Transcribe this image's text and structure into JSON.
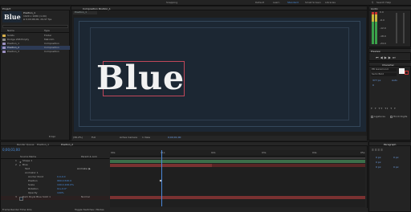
{
  "menubar": {
    "items": [
      "Snapping",
      "Default",
      "Learn",
      "Standard",
      "Small Screen",
      "Libraries"
    ],
    "search_placeholder": "Search Help"
  },
  "project": {
    "tab_label": "Project",
    "preview_title": "Blue",
    "preview_name": "Position_1",
    "preview_info": [
      "1920 x 1080 (1.00)",
      "Δ 0;00;06;00, 29.97 fps"
    ],
    "columns": [
      "Name",
      "Type"
    ],
    "items": [
      {
        "name": "Solids",
        "type": "Folder"
      },
      {
        "name": "Dodge 268 Empty",
        "type": "Mat.Clm"
      },
      {
        "name": "Position_1",
        "type": "Composition"
      },
      {
        "name": "Position_2",
        "type": "Composition"
      },
      {
        "name": "Position_3",
        "type": "Composition"
      }
    ],
    "bpc": "8 bpc"
  },
  "composition": {
    "tab_label": "Composition Position_1",
    "breadcrumb": "Position_1",
    "title_text": "Blue",
    "footer": {
      "zoom": "(36.2%)",
      "resolution": "Full",
      "camera": "Active Camera",
      "views": "1 View",
      "time": "0;00;01;00"
    }
  },
  "info_panel": {
    "tab_label": "Audio",
    "db_labels": [
      "0.0",
      "-3.0",
      "-6.0",
      "-9.0",
      "-12.0",
      "-15.0",
      "-18.0",
      "-21.0",
      "-24.0"
    ]
  },
  "preview_panel": {
    "tab_label": "Preview"
  },
  "character_panel": {
    "tab_label": "Character",
    "font": "EB Garamond",
    "style": "Semi Bold",
    "size": "377 px",
    "leading": "Auto",
    "tracking": "0",
    "options": [
      "Ligatures",
      "Hindi Digits"
    ]
  },
  "timeline": {
    "tabs": [
      "Render Queue",
      "Position_1",
      "Position_2"
    ],
    "timecode": "0;00;01;00",
    "columns": [
      "Source Name",
      "Parent & Link"
    ],
    "layers": [
      {
        "num": "1",
        "name": "Shape 1"
      },
      {
        "num": "2",
        "name": "Blue"
      },
      {
        "name": "Text"
      },
      {
        "name": "Animator 1"
      },
      {
        "name": "Anchor Point",
        "value": "0.0,0.0"
      },
      {
        "name": "Position",
        "value": "960.0,540.0"
      },
      {
        "name": "Scale",
        "value": "100.0,100.0%"
      },
      {
        "name": "Rotation",
        "value": "0x+0.0°"
      },
      {
        "name": "Opacity",
        "value": "100%"
      },
      {
        "num": "3",
        "name": "Dark Royal Blue Solid 1"
      }
    ],
    "ruler_labels": [
      "00s",
      "01s",
      "02s",
      "03s",
      "04s",
      "05s"
    ],
    "footer": [
      "Frame Render Time 4ms",
      "Toggle Switches / Modes"
    ],
    "mode": "Normal"
  },
  "paragraph_panel": {
    "tab_label": "Paragraph",
    "values": [
      "0 px",
      "0 px",
      "0 px",
      "0 px",
      "0 px"
    ]
  },
  "colors": {
    "comp_bg": "#1c2733",
    "text_white": "#f2f2f2",
    "accent_blue": "#2d8ceb",
    "playhead": "#4a87d8",
    "folder": "#d8b04a"
  }
}
